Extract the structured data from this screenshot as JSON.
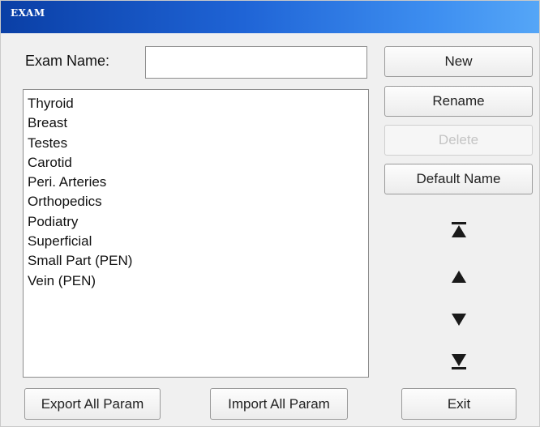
{
  "window": {
    "title": "EXAM"
  },
  "form": {
    "exam_name_label": "Exam Name:",
    "exam_name_value": ""
  },
  "exam_list": {
    "items": [
      "Thyroid",
      "Breast",
      "Testes",
      "Carotid",
      "Peri. Arteries",
      "Orthopedics",
      "Podiatry",
      "Superficial",
      "Small Part (PEN)",
      "Vein (PEN)"
    ]
  },
  "side_buttons": {
    "new": "New",
    "rename": "Rename",
    "delete": "Delete",
    "default_name": "Default Name"
  },
  "move_icons": {
    "top": "move-to-top-icon",
    "up": "move-up-icon",
    "down": "move-down-icon",
    "bottom": "move-to-bottom-icon"
  },
  "bottom_buttons": {
    "export": "Export All Param",
    "import": "Import All Param",
    "exit": "Exit"
  },
  "colors": {
    "title_gradient_start": "#0a3fa6",
    "title_gradient_end": "#55a6f7",
    "window_background": "#f0f0f0"
  }
}
